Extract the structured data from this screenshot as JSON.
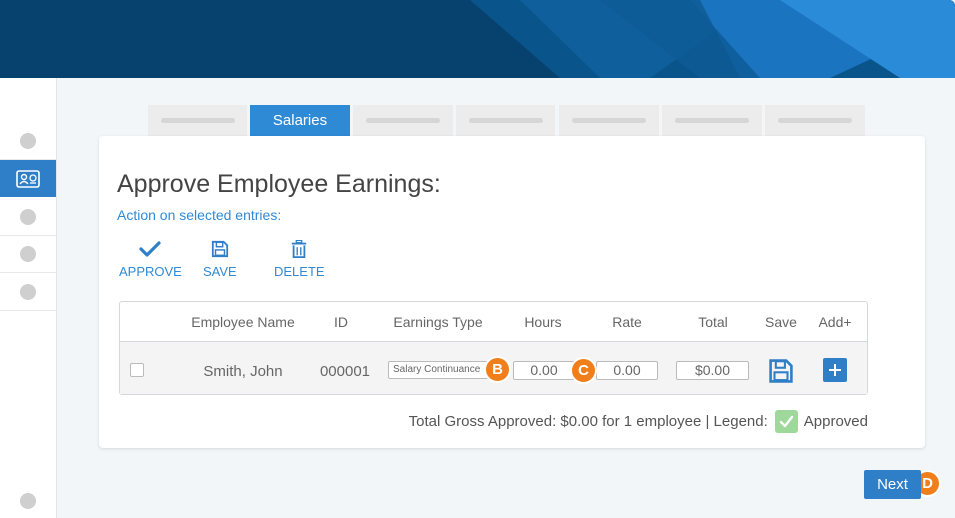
{
  "tabs": [
    {
      "label": "",
      "active": false
    },
    {
      "label": "Salaries",
      "active": true
    },
    {
      "label": "",
      "active": false
    },
    {
      "label": "",
      "active": false
    },
    {
      "label": "",
      "active": false
    },
    {
      "label": "",
      "active": false
    },
    {
      "label": "",
      "active": false
    }
  ],
  "card": {
    "title": "Approve Employee Earnings:",
    "action_label": "Action on selected entries:"
  },
  "actions": {
    "approve": "APPROVE",
    "save": "SAVE",
    "delete": "DELETE"
  },
  "table": {
    "headers": {
      "employee_name": "Employee Name",
      "id": "ID",
      "earnings_type": "Earnings Type",
      "hours": "Hours",
      "rate": "Rate",
      "total": "Total",
      "save": "Save",
      "add": "Add+"
    },
    "rows": [
      {
        "employee_name": "Smith, John",
        "id": "000001",
        "earnings_type": "Salary Continuance",
        "hours": "0.00",
        "rate": "0.00",
        "total": "$0.00"
      }
    ]
  },
  "summary": {
    "text": "Total Gross Approved: $0.00 for 1 employee | Legend:",
    "legend_label": "Approved"
  },
  "callouts": {
    "b": "B",
    "c": "C",
    "d": "D"
  },
  "footer": {
    "next_label": "Next"
  },
  "colors": {
    "accent": "#2f7fc8",
    "banner": "#0b4a7a",
    "callout": "#f07f1b",
    "approved": "#9ed89b"
  },
  "icons": {
    "sidebar_active": "id-card-icon",
    "approve": "checkmark-icon",
    "save": "floppy-disk-icon",
    "delete": "trash-icon",
    "add": "plus-icon"
  }
}
